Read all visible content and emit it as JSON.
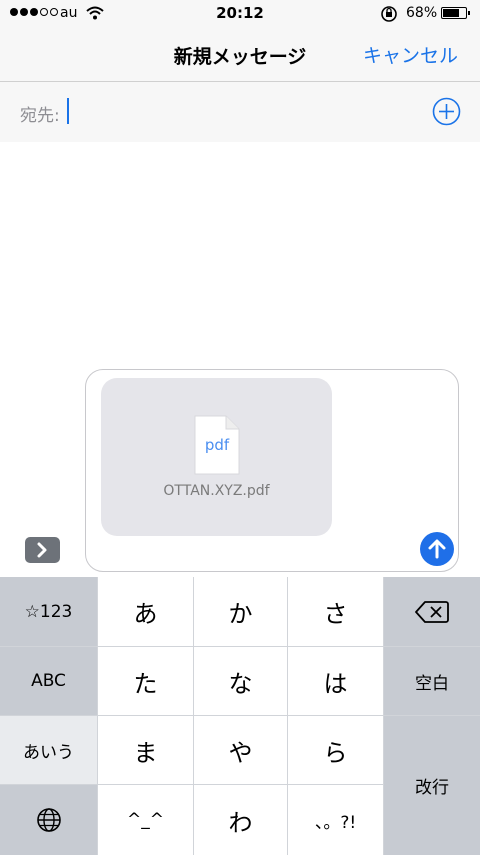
{
  "status_bar": {
    "carrier": "au",
    "time": "20:12",
    "battery": "68%",
    "icons": [
      "signal-dots-icon",
      "wifi-icon",
      "rotation-lock-icon",
      "battery-icon"
    ]
  },
  "nav": {
    "title": "新規メッセージ",
    "cancel_label": "キャンセル"
  },
  "recipient": {
    "label": "宛先:",
    "value": ""
  },
  "attachment": {
    "doc_icon_text": "pdf",
    "filename": "OTTAN.XYZ.pdf"
  },
  "keyboard": {
    "left_col": {
      "numbers": "☆123",
      "abc": "ABC",
      "kana": "あいう"
    },
    "row1": [
      "あ",
      "か",
      "さ"
    ],
    "row2": [
      "た",
      "な",
      "は"
    ],
    "row3": [
      "ま",
      "や",
      "ら"
    ],
    "row4": [
      "^_^",
      "わ",
      "、。?!"
    ],
    "space": "空白",
    "return": "改行"
  },
  "colors": {
    "accent": "#1a73e8",
    "send_button": "#1f6fe8",
    "keyboard_bg": "#d1d4d9",
    "key_white": "#ffffff",
    "key_gray": "#c7cbd2",
    "attachment_bg": "#e5e5ea"
  }
}
